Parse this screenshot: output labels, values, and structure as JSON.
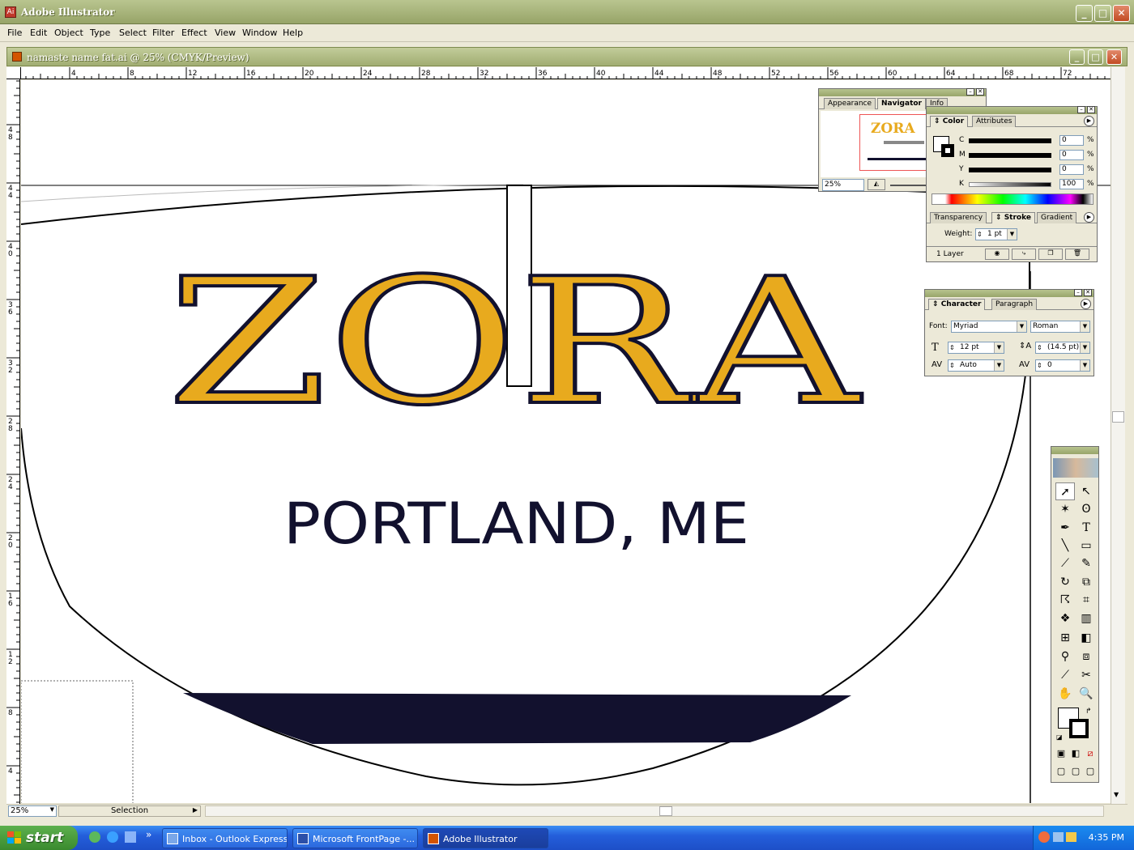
{
  "app": {
    "title": "Adobe Illustrator",
    "minimize": "_",
    "maximize": "□",
    "close": "✕"
  },
  "menu": [
    "File",
    "Edit",
    "Object",
    "Type",
    "Select",
    "Filter",
    "Effect",
    "View",
    "Window",
    "Help"
  ],
  "document": {
    "title": "namaste name fat.ai @ 25% (CMYK/Preview)"
  },
  "rulers": {
    "horizontal": [
      "4",
      "8",
      "12",
      "16",
      "20",
      "24",
      "28",
      "32",
      "36",
      "40",
      "44",
      "48",
      "52",
      "56",
      "60",
      "64",
      "68",
      "72"
    ],
    "vertical": [
      "48",
      "44",
      "40",
      "36",
      "32",
      "28",
      "24",
      "20",
      "16",
      "12",
      "8",
      "4"
    ]
  },
  "artwork": {
    "logo_text": "ZORA",
    "subtitle": "PORTLAND, ME",
    "logo_color": "#e8aa1e",
    "dark_color": "#12112e"
  },
  "navigator": {
    "tabs": [
      "Appearance",
      "Navigator",
      "Info"
    ],
    "zoom": "25%",
    "preview_text": "ZORA"
  },
  "color_palette": {
    "tabs": [
      "Color",
      "Attributes"
    ],
    "sliders": [
      {
        "label": "C",
        "value": "0"
      },
      {
        "label": "M",
        "value": "0"
      },
      {
        "label": "Y",
        "value": "0"
      },
      {
        "label": "K",
        "value": "100"
      }
    ],
    "unit": "%"
  },
  "stroke_palette": {
    "tabs": [
      "Transparency",
      "Stroke",
      "Gradient"
    ],
    "weight_label": "Weight:",
    "weight_value": "1 pt"
  },
  "layers": {
    "count_label": "1 Layer"
  },
  "character_palette": {
    "tabs": [
      "Character",
      "Paragraph"
    ],
    "font_label": "Font:",
    "font": "Myriad",
    "style": "Roman",
    "size": "12 pt",
    "leading": "(14.5 pt)",
    "kerning": "Auto",
    "tracking": "0"
  },
  "status": {
    "zoom": "25%",
    "tool": "Selection"
  },
  "taskbar": {
    "start": "start",
    "items": [
      {
        "label": "Inbox - Outlook Express",
        "active": false
      },
      {
        "label": "Microsoft FrontPage -...",
        "active": false
      },
      {
        "label": "Adobe Illustrator",
        "active": true
      }
    ],
    "clock": "4:35 PM"
  }
}
